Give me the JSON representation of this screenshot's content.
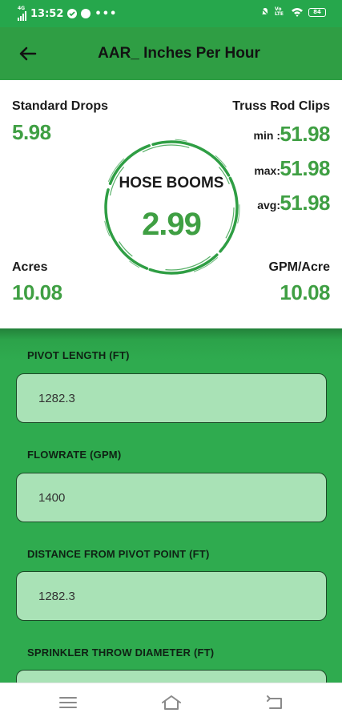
{
  "status_bar": {
    "time": "13:52",
    "network": "4G",
    "battery": "84",
    "lte": "Vo LTE"
  },
  "app_bar": {
    "title": "AAR_ Inches Per Hour"
  },
  "summary": {
    "standard_drops": {
      "label": "Standard Drops",
      "value": "5.98"
    },
    "truss_rod_clips": {
      "label": "Truss Rod Clips",
      "min_label": "min :",
      "min_value": "51.98",
      "max_label": "max:",
      "max_value": "51.98",
      "avg_label": "avg:",
      "avg_value": "51.98"
    },
    "hose_booms": {
      "label": "HOSE BOOMS",
      "value": "2.99"
    },
    "acres": {
      "label": "Acres",
      "value": "10.08"
    },
    "gpm_acre": {
      "label": "GPM/Acre",
      "value": "10.08"
    }
  },
  "form": {
    "pivot_length": {
      "label": "PIVOT LENGTH (FT)",
      "value": "1282.3"
    },
    "flowrate": {
      "label": "FLOWRATE (GPM)",
      "value": "1400"
    },
    "distance": {
      "label": "DISTANCE FROM PIVOT POINT (FT)",
      "value": "1282.3"
    },
    "throw_diameter": {
      "label": "SPRINKLER THROW DIAMETER (FT)",
      "value": ""
    }
  },
  "colors": {
    "accent_green": "#3f9f43",
    "app_bar": "#2f9e44",
    "form_bg": "#2fab4f",
    "field_bg": "#a9e2b6"
  }
}
